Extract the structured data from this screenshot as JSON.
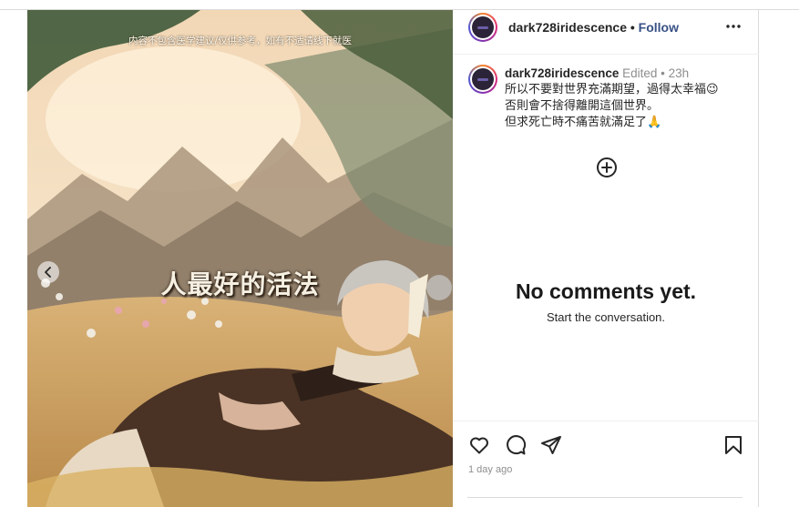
{
  "post": {
    "overlay_title": "人最好的活法",
    "overlay_disclaimer": "内容不包含医学建议/仅供参考，如有不适请线下就医"
  },
  "header": {
    "username": "dark728iridescence",
    "separator": "•",
    "follow_label": "Follow",
    "more_icon": "more-horizontal-icon"
  },
  "caption": {
    "username": "dark728iridescence",
    "edited": "Edited",
    "separator": "•",
    "time": "23h",
    "lines": [
      "所以不要對世界充滿期望，過得太幸福😉",
      "否則會不捨得離開這個世界。",
      "但求死亡時不痛苦就滿足了🙏"
    ]
  },
  "comments": {
    "empty_title": "No comments yet.",
    "empty_subtitle": "Start the conversation."
  },
  "actions": {
    "date": "1 day ago",
    "icons": [
      "heart-icon",
      "comment-icon",
      "share-icon",
      "bookmark-icon"
    ]
  },
  "colors": {
    "follow": "#385185",
    "border": "#dbdbdb",
    "muted": "#8e8e8e"
  }
}
